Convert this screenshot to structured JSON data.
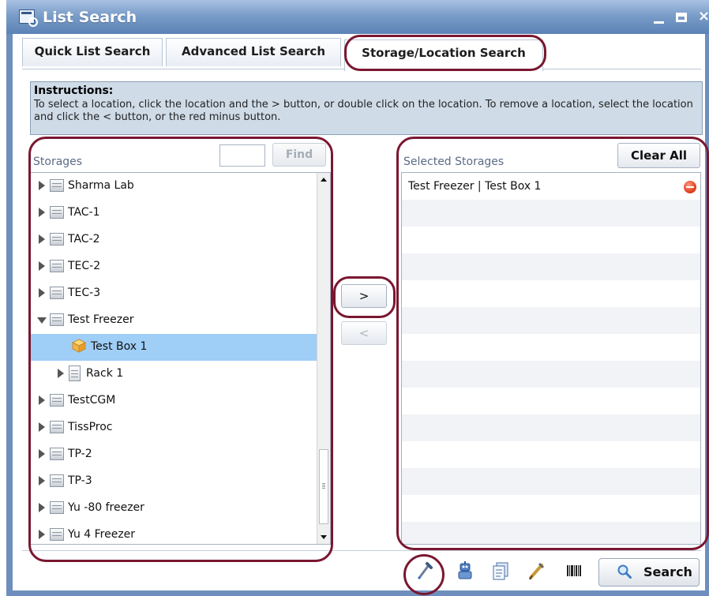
{
  "window": {
    "title": "List Search"
  },
  "tabs": [
    {
      "label": "Quick List Search"
    },
    {
      "label": "Advanced List Search"
    },
    {
      "label": "Storage/Location Search"
    }
  ],
  "instructions": {
    "title": "Instructions:",
    "body": "To select a location, click the location and the > button, or double click on the location. To remove a location, select the location and click the < button, or the red minus button."
  },
  "storages": {
    "title": "Storages",
    "find_value": "",
    "find_label": "Find",
    "items": [
      {
        "label": "Sharma Lab",
        "icon": "storage-icon",
        "expanded": false
      },
      {
        "label": "TAC-1",
        "icon": "storage-icon",
        "expanded": false
      },
      {
        "label": "TAC-2",
        "icon": "storage-icon",
        "expanded": false
      },
      {
        "label": "TEC-2",
        "icon": "storage-icon",
        "expanded": false
      },
      {
        "label": "TEC-3",
        "icon": "storage-icon",
        "expanded": false
      },
      {
        "label": "Test Freezer",
        "icon": "storage-icon",
        "expanded": true
      },
      {
        "label": "Test Box 1",
        "icon": "box-icon",
        "selected": true
      },
      {
        "label": "Rack 1",
        "icon": "rack-icon",
        "expanded": false
      },
      {
        "label": "TestCGM",
        "icon": "storage-icon",
        "expanded": false
      },
      {
        "label": "TissProc",
        "icon": "storage-icon",
        "expanded": false
      },
      {
        "label": "TP-2",
        "icon": "storage-icon",
        "expanded": false
      },
      {
        "label": "TP-3",
        "icon": "storage-icon",
        "expanded": false
      },
      {
        "label": "Yu -80 freezer",
        "icon": "storage-icon",
        "expanded": false
      },
      {
        "label": "Yu 4 Freezer",
        "icon": "storage-icon",
        "expanded": false
      }
    ]
  },
  "move": {
    "add_label": ">",
    "remove_label": "<"
  },
  "selected": {
    "title": "Selected Storages",
    "clear_label": "Clear All",
    "items": [
      {
        "label": "Test Freezer | Test Box 1"
      }
    ]
  },
  "toolbar": {
    "icons": [
      "pipette-icon",
      "robot-icon",
      "document-list-icon",
      "pen-icon",
      "barcode-icon"
    ],
    "search_label": "Search"
  },
  "colors": {
    "title_bar": "#6f93c4",
    "selection": "#9fcef6",
    "instructions_bg": "#cfdbe7",
    "highlight": "#7a1730",
    "remove": "#e2431f"
  }
}
